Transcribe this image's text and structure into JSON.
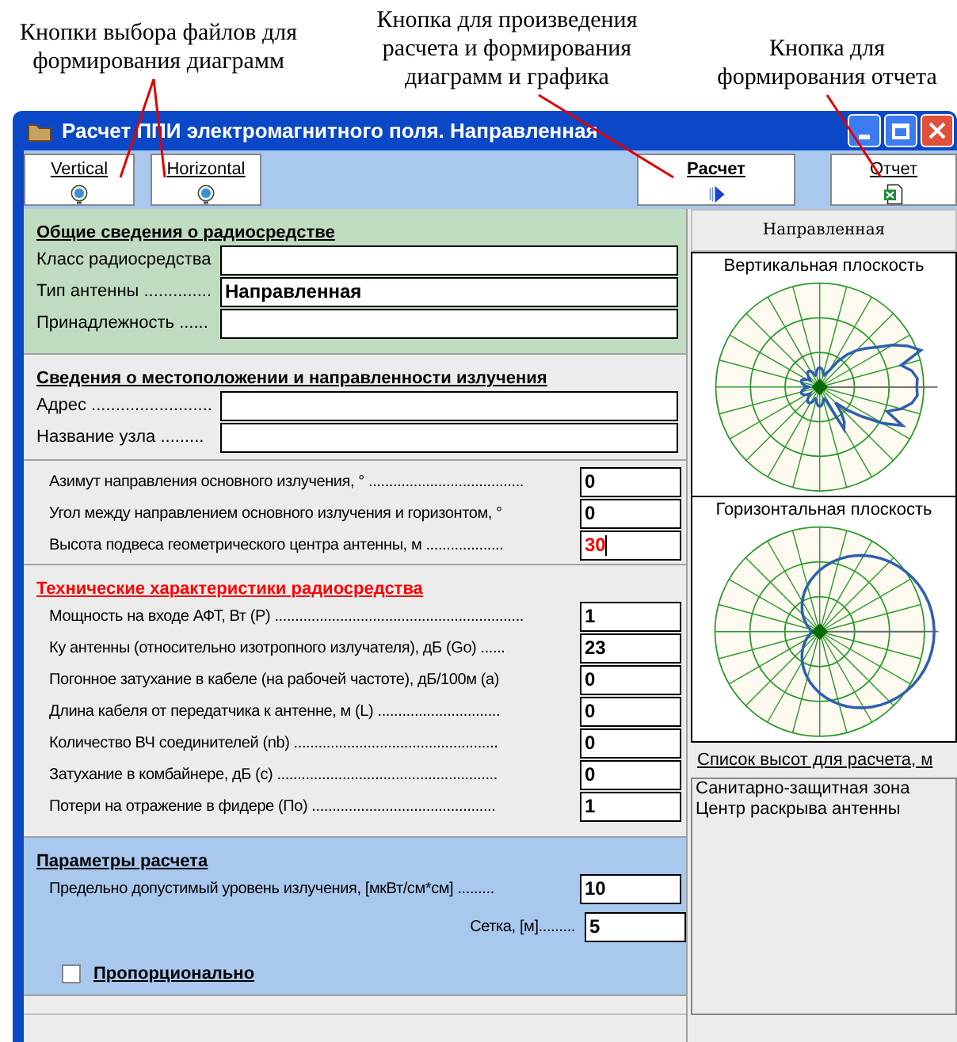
{
  "annotations": [
    {
      "text": "Кнопки выбора файлов для\nформирования диаграмм"
    },
    {
      "text": "Кнопка для произведения\nрасчета и формирования\nдиаграмм и графика"
    },
    {
      "text": "Кнопка для\nформирования отчета"
    }
  ],
  "window": {
    "title": "Расчет ППИ электромагнитного поля. Направленная"
  },
  "toolbar": [
    {
      "label": "Vertical",
      "kind": "file"
    },
    {
      "label": "Horizontal",
      "kind": "file"
    },
    {
      "label": "Расчет",
      "kind": "run"
    },
    {
      "label": "Отчет",
      "kind": "report"
    }
  ],
  "sections": [
    {
      "kind": "general",
      "title": "Общие сведения о радиосредстве",
      "fields": [
        {
          "label": "Класс радиосредства"
        },
        {
          "label": "Тип антенны ..............",
          "value": "Направленная"
        },
        {
          "label": "Принадлежность ......"
        }
      ]
    },
    {
      "kind": "location",
      "title": "Сведения о местоположении  и направленности излучения",
      "fields": [
        {
          "label": "Адрес ........................."
        },
        {
          "label": "Название узла ........."
        }
      ]
    },
    {
      "kind": "orientation",
      "fields": [
        {
          "label": "Азимут направления основного излучения, ° ......................................",
          "value": "0",
          "focused": false
        },
        {
          "label": "Угол между направлением основного излучения и горизонтом, °",
          "value": "0",
          "focused": false
        },
        {
          "label": "Высота подвеса геометрического центра антенны, м ...................",
          "value": "30",
          "focused": true
        }
      ]
    },
    {
      "kind": "technical",
      "title": "Технические характеристики радиосредства",
      "fields": [
        {
          "label": "Мощность на входе АФТ, Вт (P) .............................................................",
          "value": "1",
          "focused": false
        },
        {
          "label": "Ку антенны (относительно изотропного излучателя), дБ (Go) ......",
          "value": "23",
          "focused": false
        },
        {
          "label": "Погонное затухание в кабеле (на рабочей частоте), дБ/100м (a)",
          "value": "0",
          "focused": false
        },
        {
          "label": "Длина кабеля от передатчика к антенне, м (L) ..............................",
          "value": "0",
          "focused": false
        },
        {
          "label": "Количество ВЧ соединителей (nb) ..................................................",
          "value": "0",
          "focused": false
        },
        {
          "label": "Затухание в комбайнере, дБ (c) ......................................................",
          "value": "0",
          "focused": false
        },
        {
          "label": "Потери на отражение в фидере (По) .............................................",
          "value": "1",
          "focused": false
        }
      ]
    },
    {
      "kind": "params",
      "title": "Параметры расчета",
      "fields": [
        {
          "label": "Предельно допустимый уровень излучения, [мкВт/см*см] .........",
          "value": "10",
          "focused": false
        },
        {
          "label": "Сетка, [м].........",
          "value": "5",
          "focused": false
        }
      ],
      "checkbox": {
        "label": "Пропорционально",
        "checked": false
      }
    }
  ],
  "right_panel": {
    "header": "Направленная",
    "charts": [
      {
        "title": "Вертикальная плоскость",
        "kind": "vertical"
      },
      {
        "title": "Горизонтальная плоскость",
        "kind": "horizontal"
      }
    ],
    "link": "Список высот для расчета, м",
    "list": [
      "Санитарно-защитная зона",
      "Центр раскрыва антенны"
    ]
  }
}
